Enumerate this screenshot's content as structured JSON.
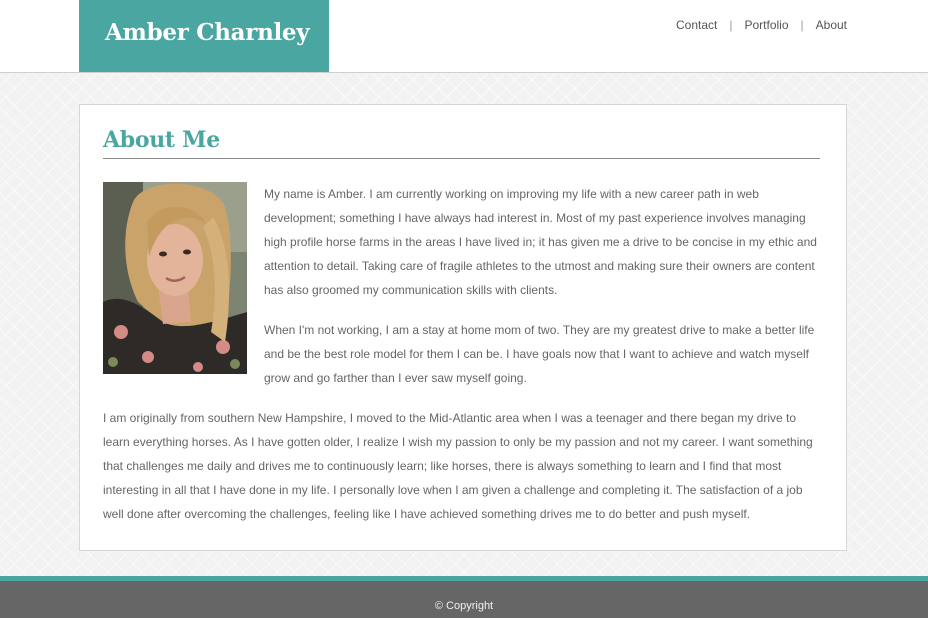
{
  "header": {
    "logo_text": "Amber Charnley",
    "nav": {
      "contact": "Contact",
      "portfolio": "Portfolio",
      "about": "About",
      "separator": "|"
    }
  },
  "main": {
    "title": "About Me",
    "paragraphs": [
      "My name is Amber. I am currently working on improving my life with a new career path in web development; something I have always had interest in. Most of my past experience involves managing high profile horse farms in the areas I have lived in; it has given me a drive to be concise in my ethic and attention to detail. Taking care of fragile athletes to the utmost and making sure their owners are content has also groomed my communication skills with clients.",
      "When I'm not working, I am a stay at home mom of two. They are my greatest drive to make a better life and be the best role model for them I can be. I have goals now that I want to achieve and watch myself grow and go farther than I ever saw myself going.",
      "I am originally from southern New Hampshire, I moved to the Mid-Atlantic area when I was a teenager and there began my drive to learn everything horses. As I have gotten older, I realize I wish my passion to only be my passion and not my career. I want something that challenges me daily and drives me to continuously learn; like horses, there is always something to learn and I find that most interesting in all that I have done in my life. I personally love when I am given a challenge and completing it. The satisfaction of a job well done after overcoming the challenges, feeling like I have achieved something drives me to do better and push myself."
    ]
  },
  "footer": {
    "copyright": "© Copyright"
  },
  "colors": {
    "accent": "#4aa6a1",
    "footer_bg": "#666666",
    "text": "#666666"
  }
}
